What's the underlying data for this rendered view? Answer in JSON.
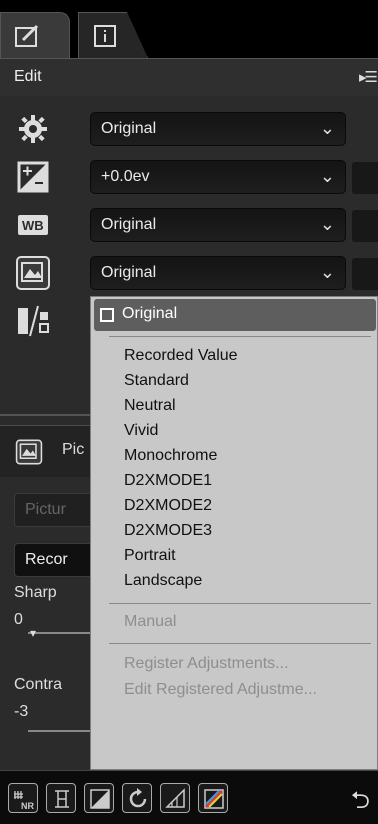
{
  "tabs": [
    {
      "name": "edit-tab-icon"
    },
    {
      "name": "info-tab-icon"
    }
  ],
  "edit_header": {
    "title": "Edit",
    "menu_icon": "▸☰"
  },
  "rows": [
    {
      "icon": "gear-icon",
      "value": "Original"
    },
    {
      "icon": "exposure-compensation-icon",
      "value": "+0.0ev"
    },
    {
      "icon": "white-balance-icon",
      "value": "Original"
    },
    {
      "icon": "picture-control-icon",
      "value": "Original"
    }
  ],
  "sub_panel": {
    "header_label": "Pic",
    "picture_field": "Pictur",
    "recorded_field": "Recor",
    "sharpening_label": "Sharp",
    "sharpening_value": "0",
    "contrast_label": "Contra",
    "contrast_value": "-3"
  },
  "menu": {
    "selected": "Original",
    "items_main": [
      "Recorded Value",
      "Standard",
      "Neutral",
      "Vivid",
      "Monochrome",
      "D2XMODE1",
      "D2XMODE2",
      "D2XMODE3",
      "Portrait",
      "Landscape"
    ],
    "manual": "Manual",
    "register": "Register Adjustments...",
    "edit_registered": "Edit Registered Adjustme..."
  },
  "toolbar": {
    "buttons": [
      "noise-reduction-icon",
      "straighten-icon",
      "levels-icon",
      "rotate-icon",
      "perspective-icon",
      "color-curve-icon"
    ],
    "undo": "⮌"
  }
}
